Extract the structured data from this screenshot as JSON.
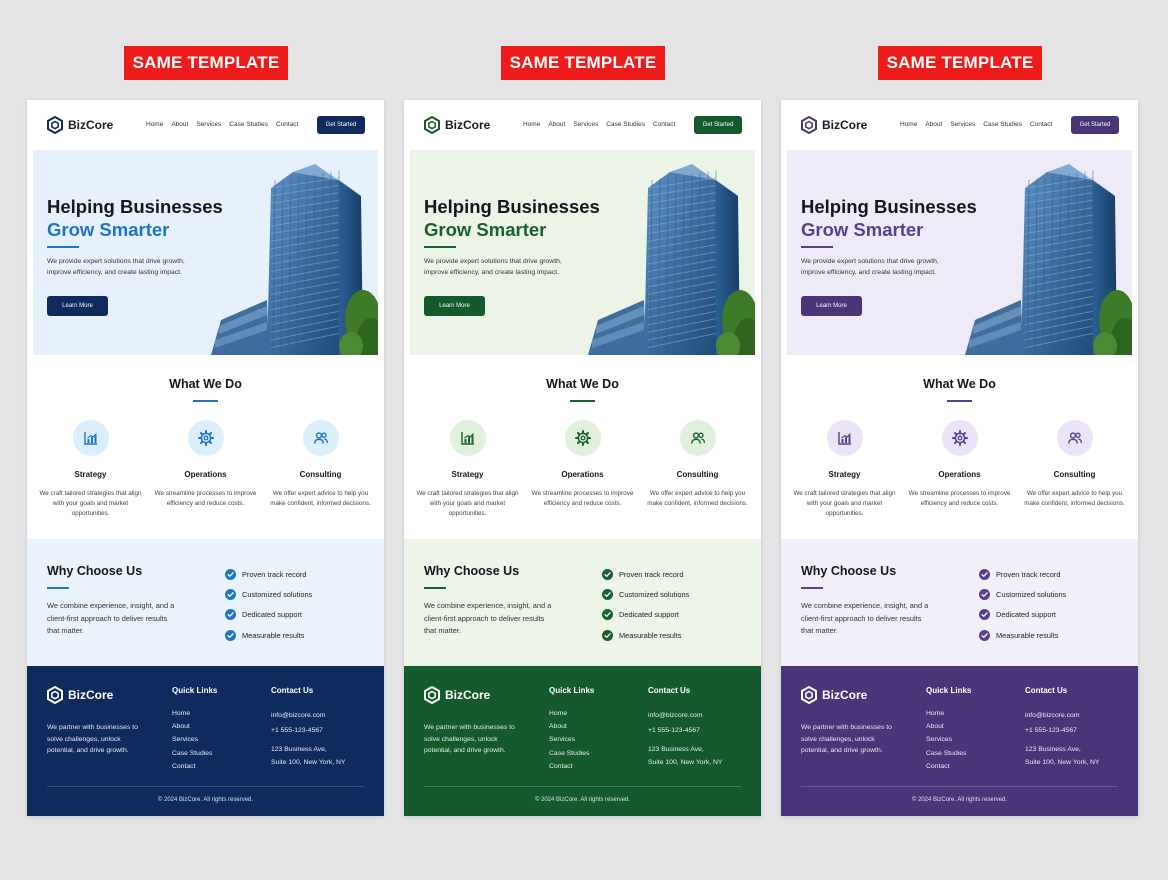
{
  "badge_label": "SAME TEMPLATE",
  "brand": "BizCore",
  "nav": {
    "links": [
      "Home",
      "About",
      "Services",
      "Case Studies",
      "Contact"
    ],
    "cta": "Get Started"
  },
  "hero": {
    "title_line1": "Helping Businesses",
    "title_line2": "Grow Smarter",
    "text": "We provide expert solutions that drive growth, improve efficiency, and create lasting impact.",
    "button": "Learn More"
  },
  "what_we_do": {
    "title": "What We Do",
    "services": [
      {
        "title": "Strategy",
        "text": "We craft tailored strategies that align with your goals and market opportunities.",
        "icon": "bar-chart-icon"
      },
      {
        "title": "Operations",
        "text": "We streamline processes to improve efficiency and reduce costs.",
        "icon": "gear-icon"
      },
      {
        "title": "Consulting",
        "text": "We offer expert advice to help you make confident, informed decisions.",
        "icon": "users-icon"
      }
    ]
  },
  "why": {
    "title": "Why Choose Us",
    "text": "We combine experience, insight, and a client-first approach to deliver results that matter.",
    "checks": [
      "Proven track record",
      "Customized solutions",
      "Dedicated support",
      "Measurable results"
    ]
  },
  "footer": {
    "text": "We partner with businesses to solve challenges, unlock potential, and drive growth.",
    "quick_links_title": "Quick Links",
    "quick_links": [
      "Home",
      "About",
      "Services",
      "Case Studies",
      "Contact"
    ],
    "contact_title": "Contact Us",
    "email": "info@bizcore.com",
    "phone": "+1 555-123-4567",
    "address_line1": "123 Business Ave,",
    "address_line2": "Suite 100, New York, NY",
    "copyright": "© 2024 BizCore. All rights reserved."
  },
  "themes": [
    {
      "name": "blue",
      "primary": "#0f2a5c",
      "accent": "#1f74c4",
      "hero_bg": "#e6f1fc",
      "why_bg": "#eaf3fc",
      "icon_bg": "#dceefb",
      "icon_fg": "#1f74c4",
      "check": "#1f74c4",
      "footer_bg": "#0f2a5c"
    },
    {
      "name": "green",
      "primary": "#155a2c",
      "accent": "#17612e",
      "hero_bg": "#ebf4e6",
      "why_bg": "#edf5e8",
      "icon_bg": "#e1f0dc",
      "icon_fg": "#17612e",
      "check": "#17612e",
      "footer_bg": "#155a2c"
    },
    {
      "name": "purple",
      "primary": "#4a3578",
      "accent": "#5a3f8f",
      "hero_bg": "#efeaf8",
      "why_bg": "#f2eff8",
      "icon_bg": "#ebe3f8",
      "icon_fg": "#5a3f8f",
      "check": "#5a3f8f",
      "footer_bg": "#4a3578"
    }
  ]
}
